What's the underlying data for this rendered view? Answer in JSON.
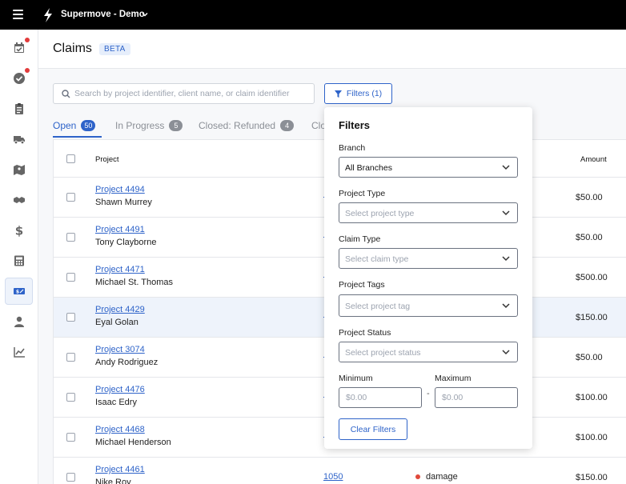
{
  "app": {
    "title": "Supermove - Demo"
  },
  "header": {
    "title": "Claims",
    "badge": "BETA"
  },
  "search": {
    "placeholder": "Search by project identifier, client name, or claim identifier"
  },
  "filter_button": {
    "label": "Filters (1)"
  },
  "tabs": [
    {
      "label": "Open",
      "count": "50",
      "active": true
    },
    {
      "label": "In Progress",
      "count": "5"
    },
    {
      "label": "Closed: Refunded",
      "count": "4"
    },
    {
      "label": "Clo"
    }
  ],
  "table": {
    "headers": {
      "project": "Project",
      "amount": "Amount"
    },
    "rows": [
      {
        "project": "Project 4494",
        "client": "Shawn Murrey",
        "amount": "$50.00"
      },
      {
        "project": "Project 4491",
        "client": "Tony Clayborne",
        "amount": "$50.00"
      },
      {
        "project": "Project 4471",
        "client": "Michael St. Thomas",
        "amount": "$500.00"
      },
      {
        "project": "Project 4429",
        "client": "Eyal Golan",
        "amount": "$150.00"
      },
      {
        "project": "Project 3074",
        "client": "Andy Rodriguez",
        "amount": "$50.00"
      },
      {
        "project": "Project 4476",
        "client": "Isaac Edry",
        "amount": "$100.00"
      },
      {
        "project": "Project 4468",
        "client": "Michael Henderson",
        "amount": "$100.00"
      },
      {
        "project": "Project 4461",
        "client": "Nike Roy",
        "claim_number": "1050",
        "claim_type": "damage",
        "amount": "$150.00"
      }
    ]
  },
  "filters": {
    "title": "Filters",
    "branch": {
      "label": "Branch",
      "value": "All Branches"
    },
    "project_type": {
      "label": "Project Type",
      "placeholder": "Select project type"
    },
    "claim_type": {
      "label": "Claim Type",
      "placeholder": "Select claim type"
    },
    "project_tags": {
      "label": "Project Tags",
      "placeholder": "Select project tag"
    },
    "project_status": {
      "label": "Project Status",
      "placeholder": "Select project status"
    },
    "minimum": {
      "label": "Minimum",
      "placeholder": "$0.00"
    },
    "maximum": {
      "label": "Maximum",
      "placeholder": "$0.00"
    },
    "separator": "-",
    "clear_label": "Clear Filters"
  },
  "colors": {
    "accent": "#2e63c9",
    "topbar": "#000000",
    "notification": "#e23b3b",
    "damage": "#e0483a"
  },
  "sidebar_icons": [
    "calendar-check-icon",
    "check-circle-icon",
    "clipboard-icon",
    "truck-icon",
    "map-icon",
    "handshake-icon",
    "dollar-icon",
    "calculator-icon",
    "claims-ticket-icon",
    "user-icon",
    "chart-line-icon"
  ]
}
